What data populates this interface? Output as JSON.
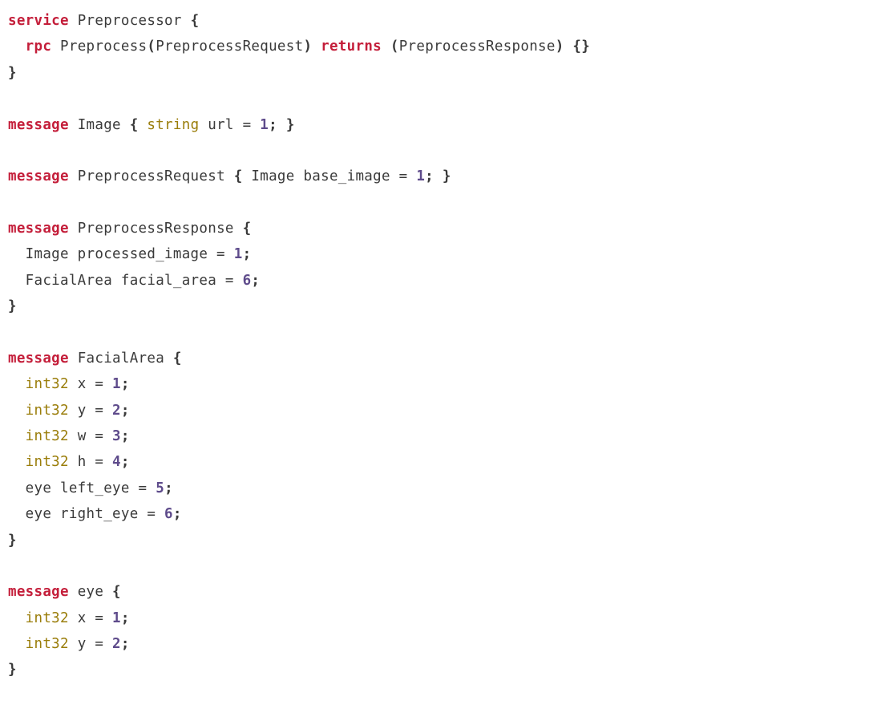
{
  "language": "protobuf",
  "definitions": [
    {
      "kind": "service",
      "name": "Preprocessor",
      "rpcs": [
        {
          "name": "Preprocess",
          "request_type": "PreprocessRequest",
          "response_type": "PreprocessResponse"
        }
      ]
    },
    {
      "kind": "message",
      "name": "Image",
      "inline": true,
      "fields": [
        {
          "type": "string",
          "name": "url",
          "tag": 1,
          "builtin": true
        }
      ]
    },
    {
      "kind": "message",
      "name": "PreprocessRequest",
      "inline": true,
      "fields": [
        {
          "type": "Image",
          "name": "base_image",
          "tag": 1,
          "builtin": false
        }
      ]
    },
    {
      "kind": "message",
      "name": "PreprocessResponse",
      "inline": false,
      "fields": [
        {
          "type": "Image",
          "name": "processed_image",
          "tag": 1,
          "builtin": false
        },
        {
          "type": "FacialArea",
          "name": "facial_area",
          "tag": 6,
          "builtin": false
        }
      ]
    },
    {
      "kind": "message",
      "name": "FacialArea",
      "inline": false,
      "fields": [
        {
          "type": "int32",
          "name": "x",
          "tag": 1,
          "builtin": true
        },
        {
          "type": "int32",
          "name": "y",
          "tag": 2,
          "builtin": true
        },
        {
          "type": "int32",
          "name": "w",
          "tag": 3,
          "builtin": true
        },
        {
          "type": "int32",
          "name": "h",
          "tag": 4,
          "builtin": true
        },
        {
          "type": "eye",
          "name": "left_eye",
          "tag": 5,
          "builtin": false
        },
        {
          "type": "eye",
          "name": "right_eye",
          "tag": 6,
          "builtin": false
        }
      ]
    },
    {
      "kind": "message",
      "name": "eye",
      "inline": false,
      "fields": [
        {
          "type": "int32",
          "name": "x",
          "tag": 1,
          "builtin": true
        },
        {
          "type": "int32",
          "name": "y",
          "tag": 2,
          "builtin": true
        }
      ]
    }
  ]
}
